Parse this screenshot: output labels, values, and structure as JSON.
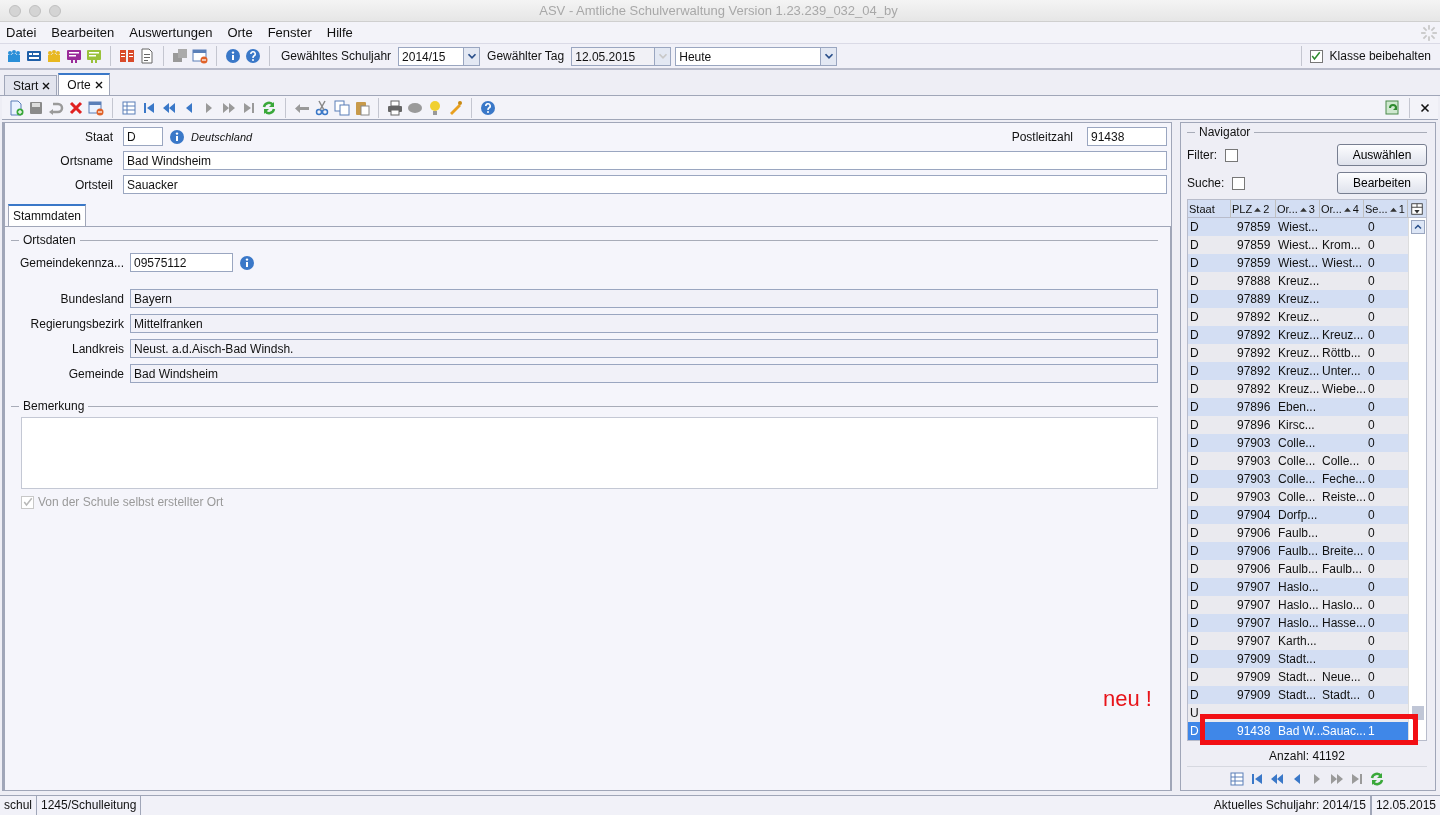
{
  "window": {
    "title": "ASV - Amtliche Schulverwaltung Version 1.23.239_032_04_by"
  },
  "menu": [
    {
      "label": "Datei"
    },
    {
      "label": "Bearbeiten"
    },
    {
      "label": "Auswertungen"
    },
    {
      "label": "Orte"
    },
    {
      "label": "Fenster"
    },
    {
      "label": "Hilfe"
    }
  ],
  "toolbar": {
    "schuljahr": {
      "label": "Gewähltes Schuljahr",
      "value": "2014/15"
    },
    "tag": {
      "label": "Gewählter Tag",
      "value": "12.05.2015",
      "disabled": true
    },
    "heute": {
      "value": "Heute"
    },
    "klasse": {
      "label": "Klasse beibehalten",
      "checked": true
    }
  },
  "tabs": [
    {
      "label": "Start",
      "selected": false
    },
    {
      "label": "Orte",
      "selected": true
    }
  ],
  "form": {
    "staat": {
      "label": "Staat",
      "value": "D",
      "name": "Deutschland"
    },
    "plz": {
      "label": "Postleitzahl",
      "value": "91438"
    },
    "ortsname": {
      "label": "Ortsname",
      "value": "Bad Windsheim"
    },
    "ortsteil": {
      "label": "Ortsteil",
      "value": "Sauacker"
    }
  },
  "subtabs": [
    {
      "label": "Stammdaten",
      "selected": true
    }
  ],
  "ortsdaten": {
    "title": "Ortsdaten",
    "gkz": {
      "label": "Gemeindekennza...",
      "value": "09575112"
    },
    "fields": [
      {
        "label": "Bundesland",
        "value": "Bayern"
      },
      {
        "label": "Regierungsbezirk",
        "value": "Mittelfranken"
      },
      {
        "label": "Landkreis",
        "value": "Neust. a.d.Aisch-Bad Windsh."
      },
      {
        "label": "Gemeinde",
        "value": "Bad Windsheim"
      }
    ]
  },
  "bemerkung": {
    "title": "Bemerkung"
  },
  "eigener_ort": {
    "label": "Von der Schule selbst erstellter Ort",
    "checked": true,
    "disabled": true
  },
  "navigator": {
    "title": "Navigator",
    "filter": {
      "label": "Filter:",
      "checked": false
    },
    "suche": {
      "label": "Suche:",
      "checked": false
    },
    "buttons": [
      {
        "label": "Auswählen"
      },
      {
        "label": "Bearbeiten"
      }
    ],
    "columns": [
      {
        "label": "Staat"
      },
      {
        "label": "PLZ",
        "sort": "2"
      },
      {
        "label": "Or...",
        "sort": "3"
      },
      {
        "label": "Or...",
        "sort": "4"
      },
      {
        "label": "Se...",
        "sort": "1"
      }
    ],
    "rows": [
      {
        "cells": [
          "D",
          "97859",
          "Wiest...",
          null,
          "0"
        ],
        "selected": false
      },
      {
        "cells": [
          "D",
          "97859",
          "Wiest...",
          "Krom...",
          "0"
        ],
        "selected": false
      },
      {
        "cells": [
          "D",
          "97859",
          "Wiest...",
          "Wiest...",
          "0"
        ],
        "selected": false
      },
      {
        "cells": [
          "D",
          "97888",
          "Kreuz...",
          null,
          "0"
        ],
        "selected": false
      },
      {
        "cells": [
          "D",
          "97889",
          "Kreuz...",
          null,
          "0"
        ],
        "selected": false
      },
      {
        "cells": [
          "D",
          "97892",
          "Kreuz...",
          null,
          "0"
        ],
        "selected": false
      },
      {
        "cells": [
          "D",
          "97892",
          "Kreuz...",
          "Kreuz...",
          "0"
        ],
        "selected": false
      },
      {
        "cells": [
          "D",
          "97892",
          "Kreuz...",
          "Röttb...",
          "0"
        ],
        "selected": false
      },
      {
        "cells": [
          "D",
          "97892",
          "Kreuz...",
          "Unter...",
          "0"
        ],
        "selected": false
      },
      {
        "cells": [
          "D",
          "97892",
          "Kreuz...",
          "Wiebe...",
          "0"
        ],
        "selected": false
      },
      {
        "cells": [
          "D",
          "97896",
          "Eben...",
          null,
          "0"
        ],
        "selected": false
      },
      {
        "cells": [
          "D",
          "97896",
          "Kirsc...",
          null,
          "0"
        ],
        "selected": false
      },
      {
        "cells": [
          "D",
          "97903",
          "Colle...",
          null,
          "0"
        ],
        "selected": false
      },
      {
        "cells": [
          "D",
          "97903",
          "Colle...",
          "Colle...",
          "0"
        ],
        "selected": false
      },
      {
        "cells": [
          "D",
          "97903",
          "Colle...",
          "Feche...",
          "0"
        ],
        "selected": false
      },
      {
        "cells": [
          "D",
          "97903",
          "Colle...",
          "Reiste...",
          "0"
        ],
        "selected": false
      },
      {
        "cells": [
          "D",
          "97904",
          "Dorfp...",
          null,
          "0"
        ],
        "selected": false
      },
      {
        "cells": [
          "D",
          "97906",
          "Faulb...",
          null,
          "0"
        ],
        "selected": false
      },
      {
        "cells": [
          "D",
          "97906",
          "Faulb...",
          "Breite...",
          "0"
        ],
        "selected": false
      },
      {
        "cells": [
          "D",
          "97906",
          "Faulb...",
          "Faulb...",
          "0"
        ],
        "selected": false
      },
      {
        "cells": [
          "D",
          "97907",
          "Haslo...",
          null,
          "0"
        ],
        "selected": false
      },
      {
        "cells": [
          "D",
          "97907",
          "Haslo...",
          "Haslo...",
          "0"
        ],
        "selected": false
      },
      {
        "cells": [
          "D",
          "97907",
          "Haslo...",
          "Hasse...",
          "0"
        ],
        "selected": false
      },
      {
        "cells": [
          "D",
          "97907",
          "Karth...",
          null,
          "0"
        ],
        "selected": false
      },
      {
        "cells": [
          "D",
          "97909",
          "Stadt...",
          null,
          "0"
        ],
        "selected": false
      },
      {
        "cells": [
          "D",
          "97909",
          "Stadt...",
          "Neue...",
          "0"
        ],
        "selected": false
      },
      {
        "cells": [
          "D",
          "97909",
          "Stadt...",
          "Stadt...",
          "0"
        ],
        "selected": false
      },
      {
        "cells": [
          "U",
          null,
          null,
          null,
          null
        ],
        "selected": false
      },
      {
        "cells": [
          "D",
          "91438",
          "Bad W...",
          "Sauac...",
          "1"
        ],
        "selected": true
      }
    ],
    "count": "Anzahl: 41192"
  },
  "annotation": {
    "text": "neu !"
  },
  "status_bar": [
    {
      "text": "schul"
    },
    {
      "text": "1245/Schulleitung"
    },
    {
      "text": "Aktuelles Schuljahr: 2014/15"
    },
    {
      "text": "12.05.2015"
    }
  ]
}
